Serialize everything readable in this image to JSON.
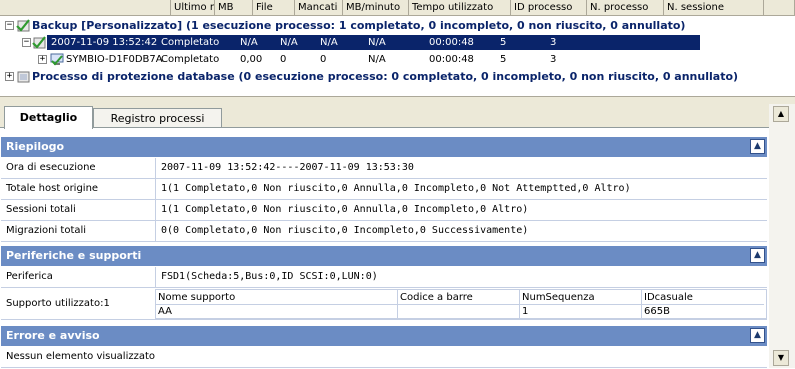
{
  "columns": [
    "Ultimo risultato",
    "MB",
    "File",
    "Mancati",
    "MB/minuto",
    "Tempo utilizzato",
    "ID processo",
    "N. processo",
    "N. sessione"
  ],
  "tree": {
    "backup_label": "Backup  [Personalizzato] (1 esecuzione processo: 1 completato, 0 incompleto, 0 non riuscito, 0 annullato)",
    "job_row": {
      "date": "2007-11-09 13:52:42",
      "result": "Completato",
      "mb": "N/A",
      "file": "N/A",
      "missed": "N/A",
      "mbmin": "N/A",
      "time": "00:00:48",
      "job_id": "5",
      "job_no": "3"
    },
    "host_row": {
      "name": "SYMBIO-D1F0DB7A",
      "result": "Completato",
      "mb": "0,00",
      "file": "0",
      "missed": "0",
      "mbmin": "N/A",
      "time": "00:00:48",
      "job_id": "5",
      "job_no": "3"
    },
    "db_label": "Processo di protezione database (0 esecuzione processo: 0 completato, 0 incompleto, 0 non riuscito, 0 annullato)"
  },
  "tabs": {
    "detail": "Dettaglio",
    "log": "Registro processi"
  },
  "summary": {
    "title": "Riepilogo",
    "rows": [
      {
        "label": "Ora di esecuzione",
        "value": "2007-11-09 13:52:42----2007-11-09 13:53:30"
      },
      {
        "label": "Totale host origine",
        "value": "1(1 Completato,0 Non riuscito,0 Annulla,0 Incompleto,0 Not Attemptted,0 Altro)"
      },
      {
        "label": "Sessioni totali",
        "value": "1(1 Completato,0 Non riuscito,0 Annulla,0 Incompleto,0 Altro)"
      },
      {
        "label": "Migrazioni totali",
        "value": "0(0 Completato,0 Non riuscito,0 Incompleto,0 Successivamente)"
      }
    ]
  },
  "devices": {
    "title": "Periferiche e supporti",
    "device_label": "Periferica",
    "device_value": "FSD1(Scheda:5,Bus:0,ID SCSI:0,LUN:0)",
    "media_label": "Supporto utilizzato:1",
    "media_headers": [
      "Nome supporto",
      "Codice a barre",
      "NumSequenza",
      "IDcasuale"
    ],
    "media_values": [
      "AA",
      "",
      "1",
      "665B"
    ]
  },
  "errors": {
    "title": "Errore e avviso",
    "empty_text": "Nessun elemento visualizzato"
  },
  "colors": {
    "section": "#6b8cc4",
    "selection": "#0a246a",
    "check": "#2f9a2f"
  }
}
